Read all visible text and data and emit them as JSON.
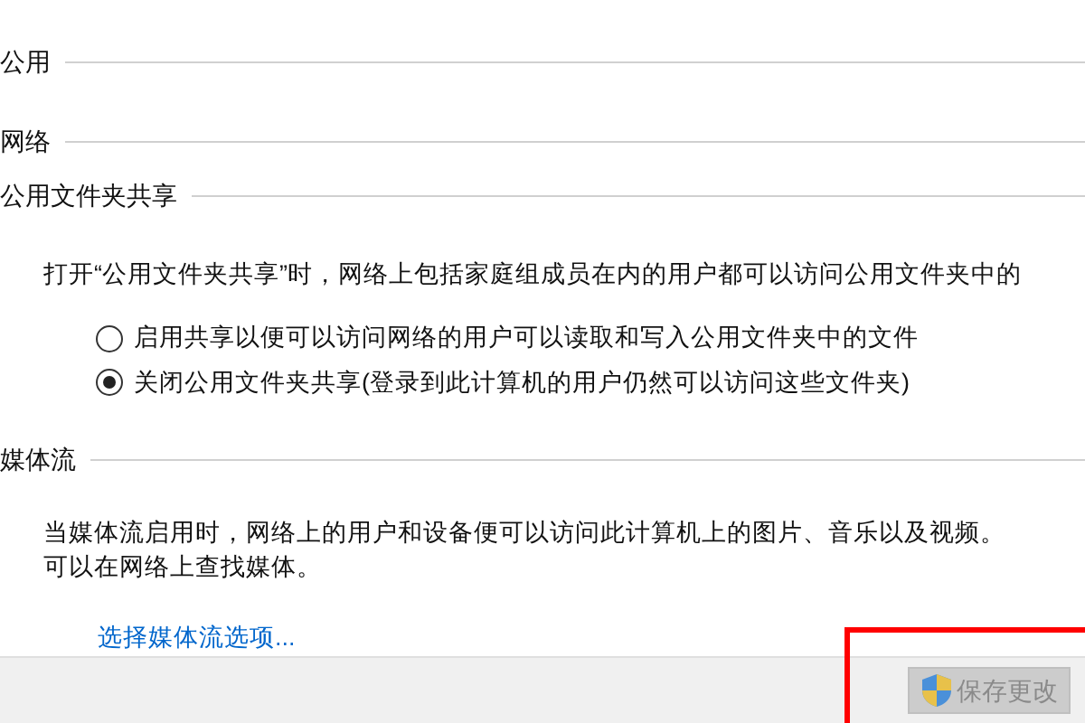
{
  "sections": [
    {
      "heading": "公用"
    },
    {
      "heading": "网络"
    },
    {
      "heading": "公用文件夹共享",
      "description": "打开“公用文件夹共享”时，网络上包括家庭组成员在内的用户都可以访问公用文件夹中的",
      "options": [
        {
          "label": "启用共享以便可以访问网络的用户可以读取和写入公用文件夹中的文件",
          "selected": false
        },
        {
          "label": "关闭公用文件夹共享(登录到此计算机的用户仍然可以访问这些文件夹)",
          "selected": true
        }
      ]
    },
    {
      "heading": "媒体流",
      "description_lines": [
        "当媒体流启用时，网络上的用户和设备便可以访问此计算机上的图片、音乐以及视频。",
        "可以在网络上查找媒体。"
      ],
      "link": "选择媒体流选项..."
    }
  ],
  "footer": {
    "save_button": {
      "label": "保存更改",
      "disabled": true
    }
  }
}
